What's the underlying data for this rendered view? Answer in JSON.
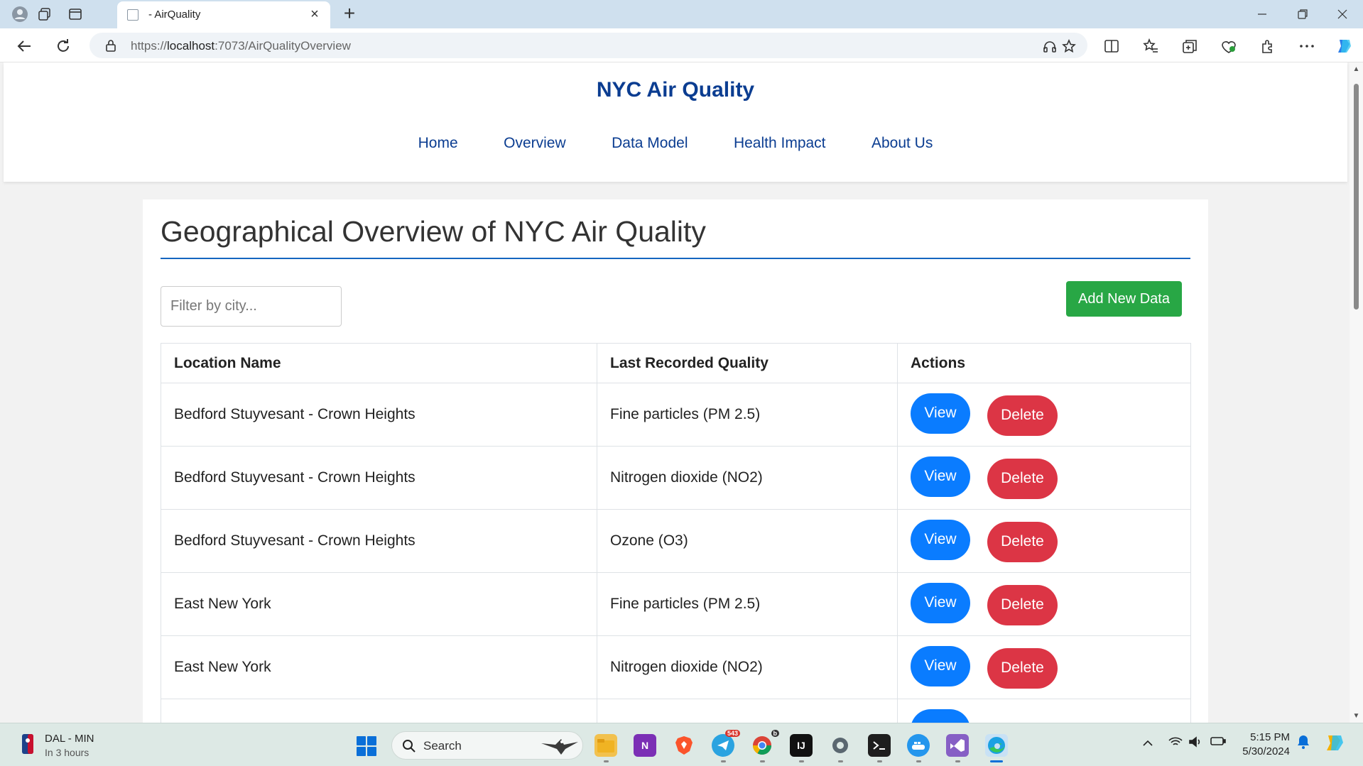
{
  "browser": {
    "tab_title": "- AirQuality",
    "url_prefix": "https://",
    "url_host": "localhost",
    "url_rest": ":7073/AirQualityOverview"
  },
  "site": {
    "title": "NYC Air Quality",
    "nav": [
      "Home",
      "Overview",
      "Data Model",
      "Health Impact",
      "About Us"
    ]
  },
  "page": {
    "heading": "Geographical Overview of NYC Air Quality",
    "filter_placeholder": "Filter by city...",
    "add_button": "Add New Data",
    "columns": [
      "Location Name",
      "Last Recorded Quality",
      "Actions"
    ],
    "rows": [
      {
        "location": "Bedford Stuyvesant - Crown Heights",
        "quality": "Fine particles (PM 2.5)"
      },
      {
        "location": "Bedford Stuyvesant - Crown Heights",
        "quality": "Nitrogen dioxide (NO2)"
      },
      {
        "location": "Bedford Stuyvesant - Crown Heights",
        "quality": "Ozone (O3)"
      },
      {
        "location": "East New York",
        "quality": "Fine particles (PM 2.5)"
      },
      {
        "location": "East New York",
        "quality": "Nitrogen dioxide (NO2)"
      },
      {
        "location": "",
        "quality": ""
      }
    ],
    "view_label": "View",
    "delete_label": "Delete"
  },
  "taskbar": {
    "weather_title": "DAL - MIN",
    "weather_sub": "In 3 hours",
    "search_label": "Search",
    "telegram_badge": "543",
    "chrome_badge": "b",
    "time": "5:15 PM",
    "date": "5/30/2024"
  },
  "colors": {
    "brand": "#0b3d91",
    "view_button": "#0a7cff",
    "delete_button": "#dc3545",
    "add_button": "#28a745"
  }
}
